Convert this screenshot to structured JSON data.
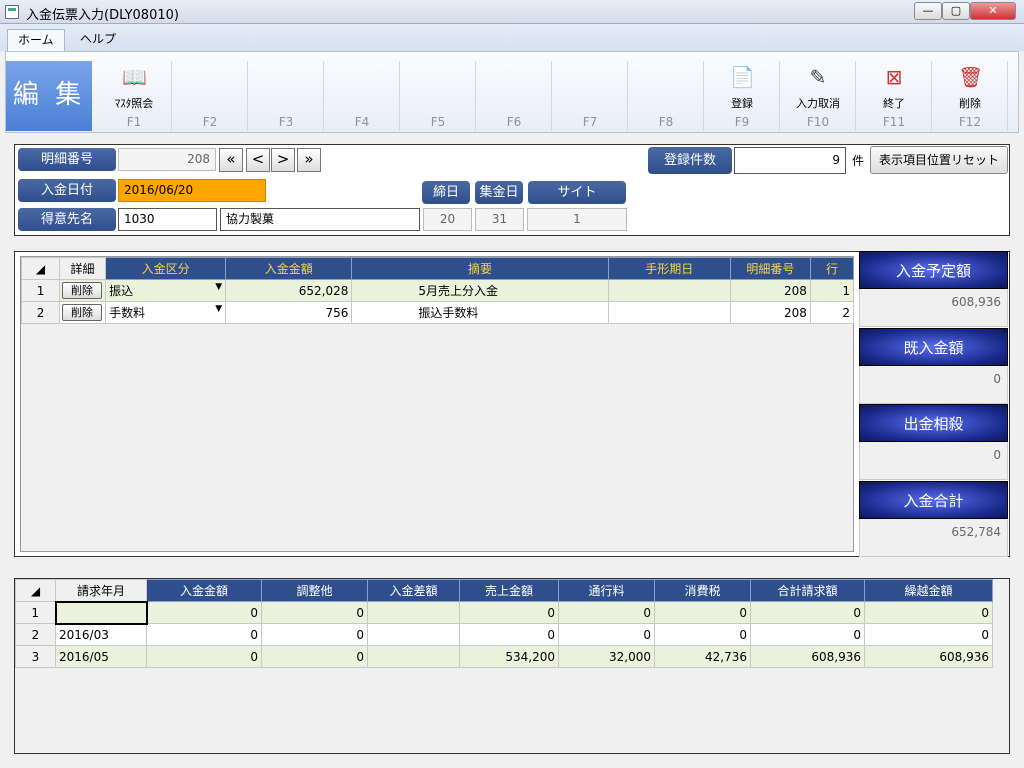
{
  "window": {
    "title": "入金伝票入力(DLY08010)",
    "min": "—",
    "max": "▢",
    "close": "✕"
  },
  "ribbon_tabs": [
    "ホーム",
    "ヘルプ"
  ],
  "edit_block": "編 集",
  "fkeys": [
    {
      "label": "ﾏｽﾀ照会",
      "key": "F1",
      "icon": "master-lookup-icon",
      "glyph": "📖"
    },
    {
      "label": "",
      "key": "F2"
    },
    {
      "label": "",
      "key": "F3"
    },
    {
      "label": "",
      "key": "F4"
    },
    {
      "label": "",
      "key": "F5"
    },
    {
      "label": "",
      "key": "F6"
    },
    {
      "label": "",
      "key": "F7"
    },
    {
      "label": "",
      "key": "F8"
    },
    {
      "label": "登録",
      "key": "F9",
      "icon": "register-icon",
      "glyph": "📄"
    },
    {
      "label": "入力取消",
      "key": "F10",
      "icon": "eraser-icon",
      "glyph": "✎"
    },
    {
      "label": "終了",
      "key": "F11",
      "icon": "exit-icon",
      "glyph": "⊠"
    },
    {
      "label": "削除",
      "key": "F12",
      "icon": "trash-icon",
      "glyph": "🗑"
    }
  ],
  "header": {
    "detail_no_label": "明細番号",
    "detail_no": "208",
    "nav": [
      "«",
      "<",
      ">",
      "»"
    ],
    "date_label": "入金日付",
    "date": "2016/06/20",
    "customer_label": "得意先名",
    "customer_code": "1030",
    "customer_name": "協力製菓",
    "count_label": "登録件数",
    "count": "9",
    "count_unit": "件",
    "reset_button": "表示項目位置リセット",
    "close_day_label": "締日",
    "close_day": "20",
    "collect_day_label": "集金日",
    "collect_day": "31",
    "site_label": "サイト",
    "site": "1"
  },
  "detail_grid": {
    "headers": [
      "詳細",
      "入金区分",
      "入金金額",
      "摘要",
      "手形期日",
      "明細番号",
      "行"
    ],
    "rows": [
      {
        "n": "1",
        "del": "削除",
        "type": "振込",
        "amount": "652,028",
        "memo": "5月売上分入金",
        "due": "",
        "detail_no": "208",
        "line": "1"
      },
      {
        "n": "2",
        "del": "削除",
        "type": "手数料",
        "amount": "756",
        "memo": "振込手数料",
        "due": "",
        "detail_no": "208",
        "line": "2"
      }
    ]
  },
  "summary": [
    {
      "label": "入金予定額",
      "value": "608,936"
    },
    {
      "label": "既入金額",
      "value": "0"
    },
    {
      "label": "出金相殺",
      "value": "0"
    },
    {
      "label": "入金合計",
      "value": "652,784"
    }
  ],
  "billing_grid": {
    "headers": [
      "請求年月",
      "入金金額",
      "調整他",
      "入金差額",
      "売上金額",
      "通行料",
      "消費税",
      "合計請求額",
      "繰越金額"
    ],
    "rows": [
      {
        "n": "1",
        "cells": [
          "",
          "0",
          "0",
          "",
          "0",
          "0",
          "0",
          "0",
          "0"
        ]
      },
      {
        "n": "2",
        "cells": [
          "2016/03",
          "0",
          "0",
          "",
          "0",
          "0",
          "0",
          "0",
          "0"
        ]
      },
      {
        "n": "3",
        "cells": [
          "2016/05",
          "0",
          "0",
          "",
          "534,200",
          "32,000",
          "42,736",
          "608,936",
          "608,936"
        ]
      }
    ]
  }
}
